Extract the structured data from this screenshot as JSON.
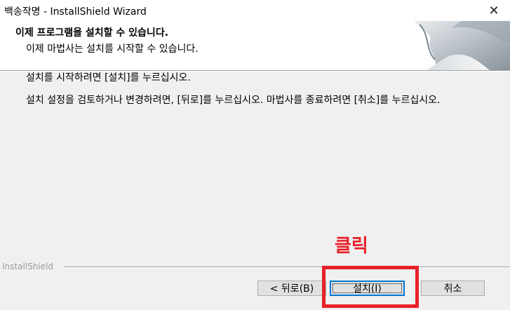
{
  "window": {
    "title": "백송작명 - InstallShield Wizard",
    "close_glyph": "✕"
  },
  "header": {
    "title": "이제 프로그램을 설치할 수 있습니다.",
    "subtitle": "이제 마법사는 설치를 시작할 수 있습니다."
  },
  "body": {
    "line1": "설치를 시작하려면 [설치]를 누르십시오.",
    "line2": "설치 설정을 검토하거나 변경하려면, [뒤로]를 누르십시오. 마법사를 종료하려면 [취소]를 누르십시오."
  },
  "annotation": {
    "text": "클릭",
    "color": "#e8202a"
  },
  "footer": {
    "brand": "InstallShield"
  },
  "buttons": {
    "back": "< 뒤로(B)",
    "install": "설치(I)",
    "cancel": "취소"
  },
  "colors": {
    "accent_focus": "#0078d7",
    "highlight": "#e8202a"
  }
}
